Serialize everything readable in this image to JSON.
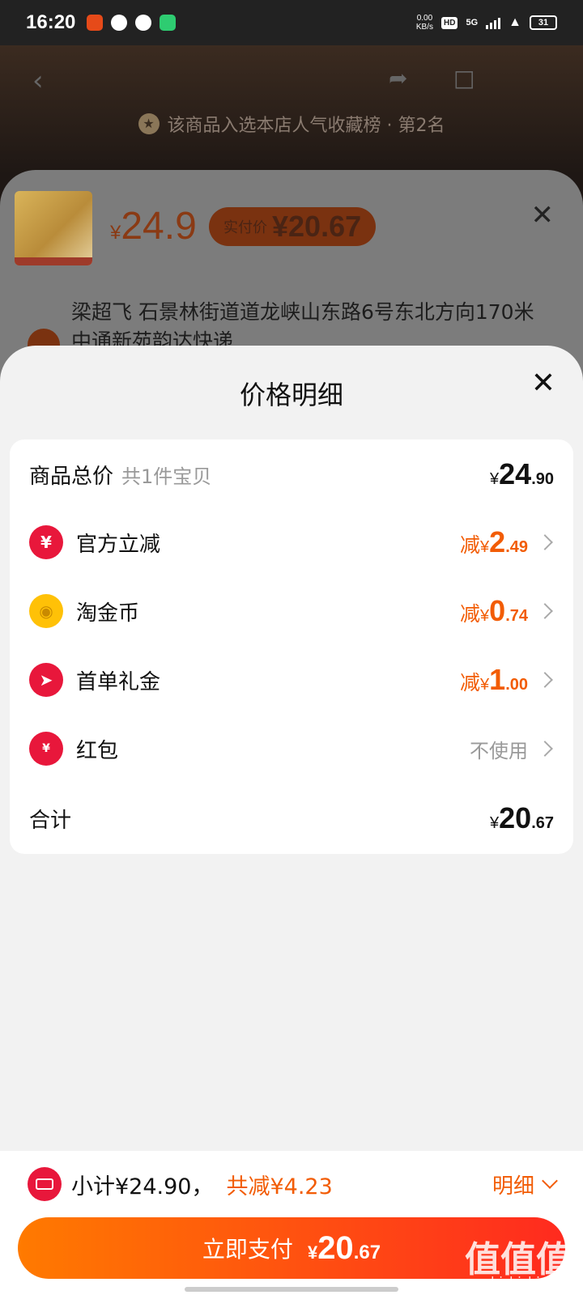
{
  "status_bar": {
    "time": "16:20",
    "net_speed": "0.00",
    "net_unit": "KB/s",
    "hd": "HD",
    "network": "5G",
    "battery": "31"
  },
  "background": {
    "rank_banner": "该商品入选本店人气收藏榜 · 第2名",
    "price_yen": "¥",
    "price": "24.9",
    "paid_label": "实付价",
    "paid_value": "¥20.67",
    "address": "梁超飞  石景林街道道龙峡山东路6号东北方向170米中通新苑韵达快递"
  },
  "sheet": {
    "title": "价格明细",
    "rows": [
      {
        "label": "商品总价",
        "sub": "共1件宝贝",
        "yen": "¥",
        "int": "24",
        "frac": ".90"
      },
      {
        "label": "官方立减",
        "prefix": "减",
        "yen": "¥",
        "int": "2",
        "frac": ".49",
        "icon": "yuan-coupon-icon",
        "color": "#e8173b"
      },
      {
        "label": "淘金币",
        "prefix": "减",
        "yen": "¥",
        "int": "0",
        "frac": ".74",
        "icon": "gold-coin-icon",
        "color": "#ffc107"
      },
      {
        "label": "首单礼金",
        "prefix": "减",
        "yen": "¥",
        "int": "1",
        "frac": ".00",
        "icon": "lightning-icon",
        "color": "#e8173b"
      },
      {
        "label": "红包",
        "value": "不使用",
        "icon": "red-packet-icon",
        "color": "#e8173b"
      },
      {
        "label": "合计",
        "yen": "¥",
        "int": "20",
        "frac": ".67"
      }
    ]
  },
  "bottom": {
    "subtotal": "小计¥24.90，",
    "saved": "共减¥4.23",
    "detail": "明细",
    "pay_label": "立即支付",
    "pay_yen": "¥",
    "pay_int": "20",
    "pay_frac": ".67"
  },
  "watermark": {
    "text": "值值值",
    "url": "zhizhizhi.com"
  },
  "colors": {
    "accent": "#f25c05",
    "brand_red": "#e8173b",
    "pay_gradient_start": "#ff7a00",
    "pay_gradient_end": "#ff2a1f"
  }
}
